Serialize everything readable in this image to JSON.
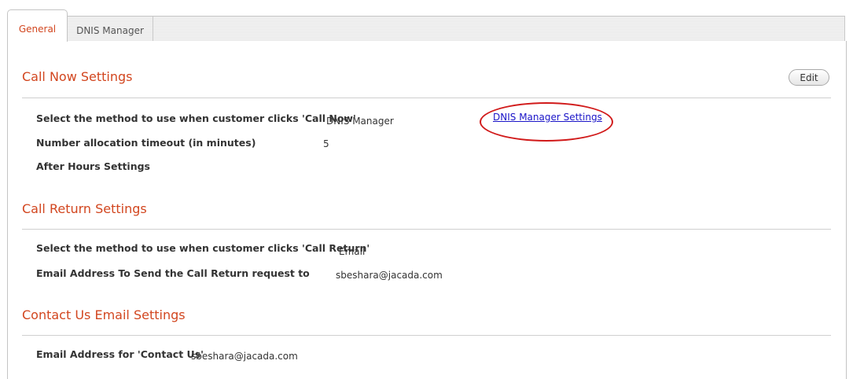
{
  "tabs": [
    {
      "label": "General",
      "active": true
    },
    {
      "label": "DNIS Manager",
      "active": false
    }
  ],
  "edit_label": "Edit",
  "call_now": {
    "title": "Call Now Settings",
    "method_label": "Select the method to use when customer clicks 'Call Now'",
    "method_value": "DNIS Manager",
    "settings_link": "DNIS Manager Settings",
    "timeout_label": "Number allocation timeout (in minutes)",
    "timeout_value": "5",
    "after_hours_label": "After Hours Settings"
  },
  "call_return": {
    "title": "Call Return Settings",
    "method_label": "Select the method to use when customer clicks 'Call Return'",
    "method_value": "Email",
    "email_label": "Email Address To Send the Call Return request to",
    "email_value": "sbeshara@jacada.com"
  },
  "contact_us": {
    "title": "Contact Us Email Settings",
    "email_label": "Email Address for 'Contact Us'",
    "email_value": "sbeshara@jacada.com"
  },
  "colors": {
    "accent": "#d2461f",
    "link": "#1a14c8",
    "highlight_oval": "#d11a1a"
  }
}
